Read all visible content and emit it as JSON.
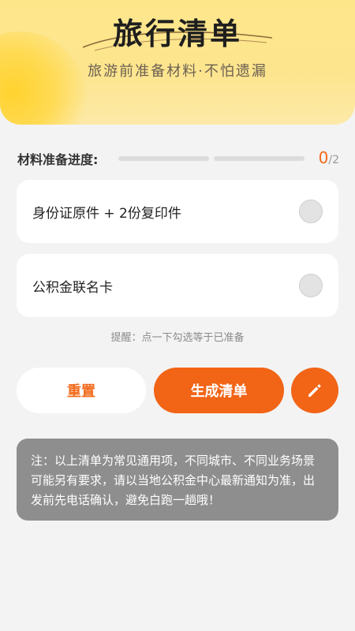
{
  "header": {
    "title": "旅行清单",
    "subtitle": "旅游前准备材料·不怕遗漏"
  },
  "progress": {
    "label": "材料准备进度:",
    "current": "0",
    "total": "/2"
  },
  "items": [
    {
      "label": "身份证原件 + 2份复印件",
      "checked": false
    },
    {
      "label": "公积金联名卡",
      "checked": false
    }
  ],
  "hint": "提醒：点一下勾选等于已准备",
  "actions": {
    "reset_label": "重置",
    "generate_label": "生成清单",
    "edit_icon": "pencil-icon"
  },
  "note": "注：以上清单为常见通用项，不同城市、不同业务场景可能另有要求，请以当地公积金中心最新通知为准，出发前先电话确认，避免白跑一趟哦！",
  "colors": {
    "accent": "#f26416",
    "header_bg": "#fde68a",
    "note_bg": "#8e8e8e"
  }
}
